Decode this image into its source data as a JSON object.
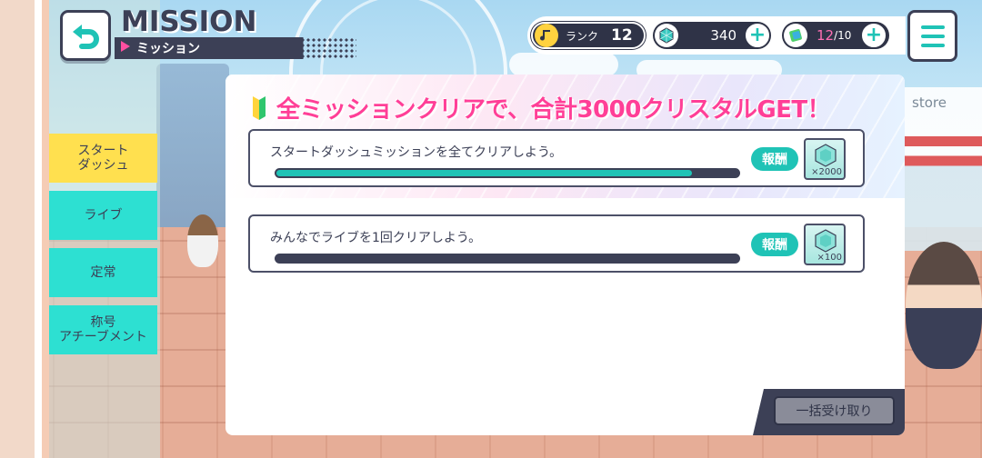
{
  "header": {
    "title": "MISSION",
    "subtitle": "ミッション",
    "rank_label": "ランク",
    "rank_value": "12",
    "crystals": "340",
    "tickets": "12",
    "tickets_max": "/10"
  },
  "sidebar": {
    "tabs": [
      {
        "label_line1": "スタート",
        "label_line2": "ダッシュ",
        "active": true
      },
      {
        "label_line1": "ライブ",
        "label_line2": "",
        "active": false
      },
      {
        "label_line1": "定常",
        "label_line2": "",
        "active": false
      },
      {
        "label_line1": "称号",
        "label_line2": "アチーブメント",
        "active": false
      }
    ]
  },
  "banner": {
    "text": "全ミッションクリアで、合計3000クリスタルGET！"
  },
  "missions": [
    {
      "text": "スタートダッシュミッションを全てクリアしよう。",
      "progress": 0.9,
      "reward_label": "報酬",
      "reward_qty": "×2000"
    },
    {
      "text": "みんなでライブを1回クリアしよう。",
      "progress": 0.0,
      "reward_label": "報酬",
      "reward_qty": "×100"
    }
  ],
  "footer": {
    "claim_all": "一括受け取り"
  },
  "background": {
    "store_sign": "store"
  },
  "colors": {
    "accent_teal": "#1fc3b6",
    "accent_pink": "#ff3f97",
    "navy": "#3c4056",
    "active_tab": "#ffe04f",
    "inactive_tab": "#2de0d2"
  }
}
